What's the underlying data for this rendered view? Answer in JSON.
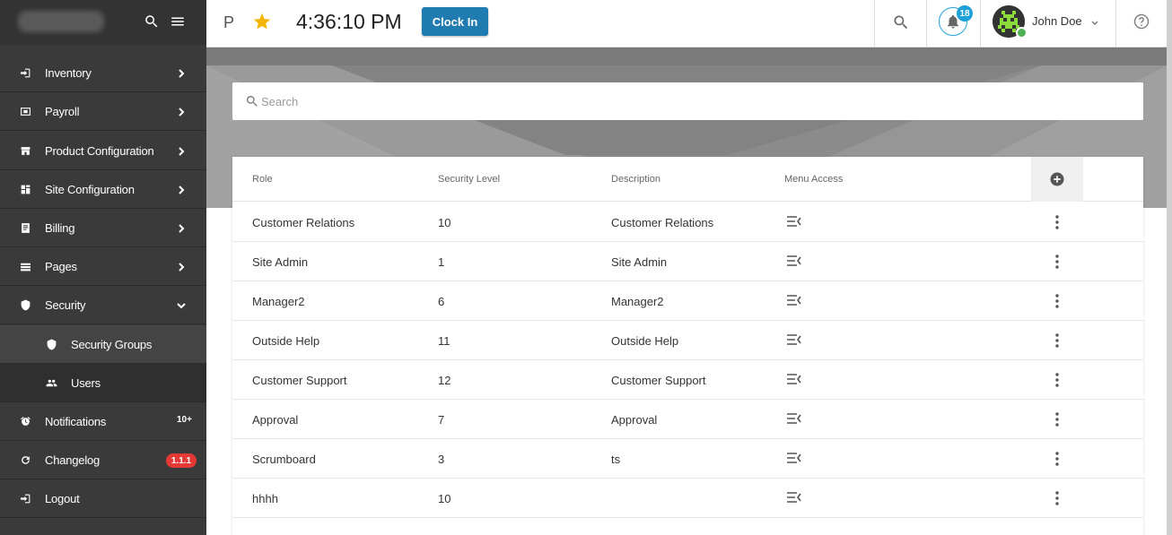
{
  "sidebar": {
    "items": [
      {
        "label": "Inventory",
        "icon": "login-icon"
      },
      {
        "label": "Payroll",
        "icon": "payroll-icon"
      },
      {
        "label": "Product Configuration",
        "icon": "store-icon"
      },
      {
        "label": "Site Configuration",
        "icon": "dashboard-icon"
      },
      {
        "label": "Billing",
        "icon": "billing-icon"
      },
      {
        "label": "Pages",
        "icon": "pages-icon"
      },
      {
        "label": "Security",
        "icon": "shield-icon"
      },
      {
        "label": "Security Groups",
        "icon": "shield-icon"
      },
      {
        "label": "Users",
        "icon": "users-icon"
      },
      {
        "label": "Notifications",
        "icon": "alarm-icon",
        "badge": "10+"
      },
      {
        "label": "Changelog",
        "icon": "refresh-icon",
        "badge": "1.1.1"
      },
      {
        "label": "Logout",
        "icon": "logout-icon"
      }
    ]
  },
  "header": {
    "p_label": "P",
    "time": "4:36:10 PM",
    "clock_in_label": "Clock In",
    "notification_count": "18",
    "user_name": "John Doe"
  },
  "search": {
    "placeholder": "Search"
  },
  "table": {
    "headers": [
      "Role",
      "Security Level",
      "Description",
      "Menu Access"
    ],
    "rows": [
      {
        "role": "Customer Relations",
        "level": "10",
        "description": "Customer Relations"
      },
      {
        "role": "Site Admin",
        "level": "1",
        "description": "Site Admin"
      },
      {
        "role": "Manager2",
        "level": "6",
        "description": "Manager2"
      },
      {
        "role": "Outside Help",
        "level": "11",
        "description": "Outside Help"
      },
      {
        "role": "Customer Support",
        "level": "12",
        "description": "Customer Support"
      },
      {
        "role": "Approval",
        "level": "7",
        "description": "Approval"
      },
      {
        "role": "Scrumboard",
        "level": "3",
        "description": "ts"
      },
      {
        "role": "hhhh",
        "level": "10",
        "description": ""
      }
    ]
  },
  "colors": {
    "sidebar_bg": "#3a3a3a",
    "accent_blue": "#1f7bb0",
    "notification_blue": "#1ea0d8",
    "badge_red": "#e53935",
    "star_gold": "#f5b400",
    "status_green": "#4caf50"
  }
}
